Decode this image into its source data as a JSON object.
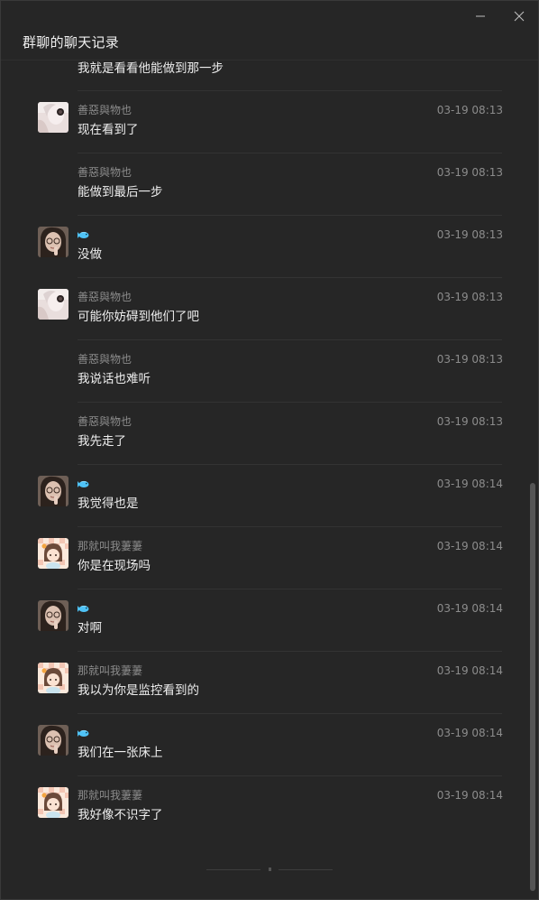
{
  "window": {
    "title": "群聊的聊天记录",
    "minimize_icon": "minimize-icon",
    "close_icon": "close-icon"
  },
  "first_message": {
    "text": "我就是看看他能做到那一步"
  },
  "messages": [
    {
      "avatar": "avatar-girl-white-hair",
      "name": "善惡與物也",
      "time": "03-19 08:13",
      "text": "现在看到了",
      "show_avatar": true
    },
    {
      "avatar": "",
      "name": "善惡與物也",
      "time": "03-19 08:13",
      "text": "能做到最后一步",
      "show_avatar": false
    },
    {
      "avatar": "avatar-girl-glasses",
      "name": "",
      "name_icon": "fish-icon",
      "time": "03-19 08:13",
      "text": "没做",
      "show_avatar": true
    },
    {
      "avatar": "avatar-girl-white-hair",
      "name": "善惡與物也",
      "time": "03-19 08:13",
      "text": "可能你妨碍到他们了吧",
      "show_avatar": true
    },
    {
      "avatar": "",
      "name": "善惡與物也",
      "time": "03-19 08:13",
      "text": "我说话也难听",
      "show_avatar": false
    },
    {
      "avatar": "",
      "name": "善惡與物也",
      "time": "03-19 08:13",
      "text": "我先走了",
      "show_avatar": false
    },
    {
      "avatar": "avatar-girl-glasses",
      "name": "",
      "name_icon": "fish-icon",
      "time": "03-19 08:14",
      "text": "我觉得也是",
      "show_avatar": true
    },
    {
      "avatar": "avatar-cartoon-girl",
      "name": "那就叫我萋萋",
      "time": "03-19 08:14",
      "text": "你是在现场吗",
      "show_avatar": true
    },
    {
      "avatar": "avatar-girl-glasses",
      "name": "",
      "name_icon": "fish-icon",
      "time": "03-19 08:14",
      "text": "对啊",
      "show_avatar": true
    },
    {
      "avatar": "avatar-cartoon-girl",
      "name": "那就叫我萋萋",
      "time": "03-19 08:14",
      "text": "我以为你是监控看到的",
      "show_avatar": true
    },
    {
      "avatar": "avatar-girl-glasses",
      "name": "",
      "name_icon": "fish-icon",
      "time": "03-19 08:14",
      "text": "我们在一张床上",
      "show_avatar": true
    },
    {
      "avatar": "avatar-cartoon-girl",
      "name": "那就叫我萋萋",
      "time": "03-19 08:14",
      "text": "我好像不识字了",
      "show_avatar": true
    }
  ],
  "colors": {
    "background": "#262626",
    "text": "#eeeeee",
    "meta": "#8c8c8c",
    "separator": "#333333",
    "fish_icon": "#4fc3f7"
  },
  "scroll": {
    "position_fraction": 1.0
  }
}
